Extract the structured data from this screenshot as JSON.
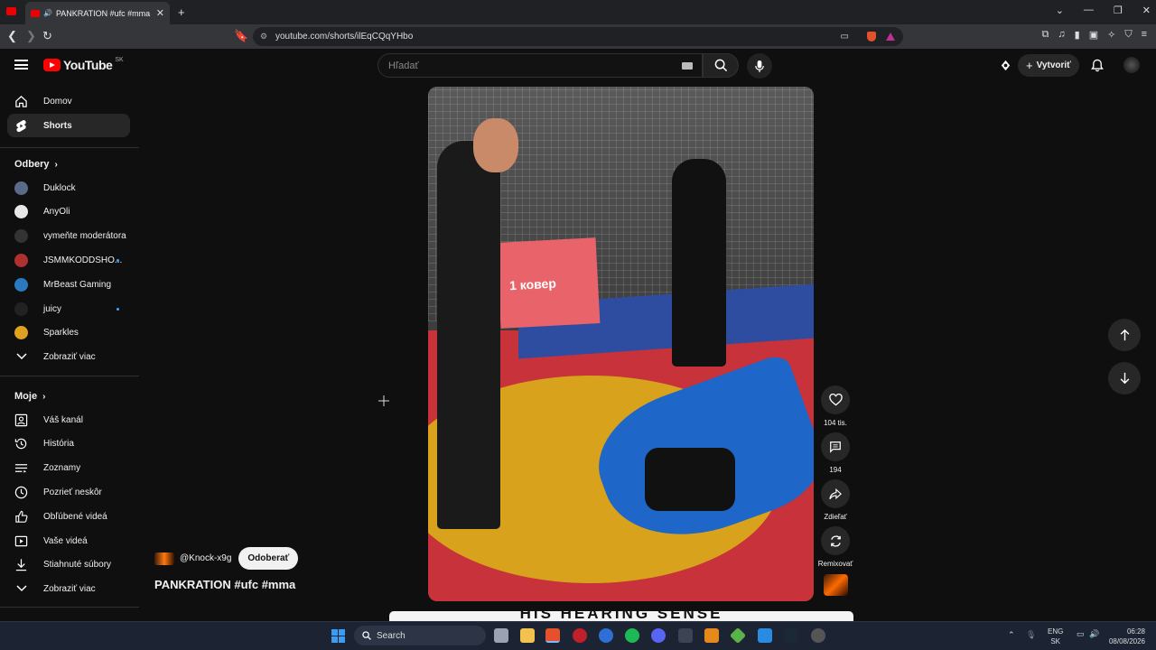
{
  "browser": {
    "tab_title": "PANKRATION #ufc #mma - YouTube",
    "url": "youtube.com/shorts/ilEqCQqYHbo"
  },
  "header": {
    "logo_text": "YouTube",
    "country_code": "SK",
    "search_placeholder": "Hľadať",
    "create_label": "Vytvoriť"
  },
  "sidebar": {
    "home": "Domov",
    "shorts": "Shorts",
    "subscriptions_title": "Odbery",
    "subscriptions": [
      {
        "label": "Duklock",
        "color": "#5a6b8a",
        "dot": false
      },
      {
        "label": "AnyOli",
        "color": "#e8e8e8",
        "dot": false
      },
      {
        "label": "vymeňte moderátora",
        "color": "#333333",
        "dot": false
      },
      {
        "label": "JSMMKODDSHO...",
        "color": "#b03030",
        "dot": true
      },
      {
        "label": "MrBeast Gaming",
        "color": "#2a7ac0",
        "dot": false
      },
      {
        "label": "juicy",
        "color": "#222222",
        "dot": true
      },
      {
        "label": "Sparkles",
        "color": "#e0a020",
        "dot": false
      }
    ],
    "show_more_1": "Zobraziť viac",
    "you_title": "Moje",
    "you_items": [
      "Váš kanál",
      "História",
      "Zoznamy",
      "Pozrieť neskôr",
      "Obľúbené videá",
      "Vaše videá",
      "Stiahnuté súbory"
    ],
    "show_more_2": "Zobraziť viac"
  },
  "short": {
    "channel": "@Knock-x9g",
    "subscribe_label": "Odoberať",
    "title": "PANKRATION #ufc #mma",
    "banner_text": "1 ковер",
    "caption_text": "HIS HEARING SENSE"
  },
  "actions": {
    "likes": "104 tis.",
    "comments": "194",
    "share": "Zdieľať",
    "remix": "Remixovať"
  },
  "taskbar": {
    "search_label": "Search",
    "lang_top": "ENG",
    "lang_bottom": "SK",
    "time": "06:28",
    "date": "08/08/2026"
  }
}
